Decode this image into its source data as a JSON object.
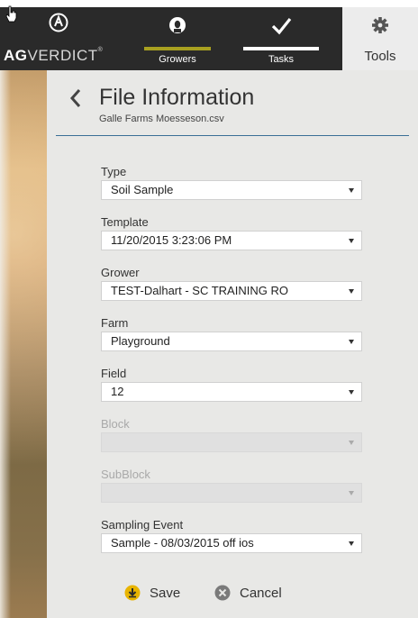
{
  "brand": {
    "bold": "AG",
    "rest": "VERDICT",
    "tm": "®"
  },
  "nav": {
    "tabs": [
      {
        "label": "Growers",
        "icon": "person-icon"
      },
      {
        "label": "Tasks",
        "icon": "checkmark-icon"
      },
      {
        "label": "Tools",
        "icon": "gear-icon"
      }
    ],
    "active_colors": {
      "growers": "#a8a020",
      "tasks": "#ffffff"
    }
  },
  "header": {
    "title": "File Information",
    "filename": "Galle Farms Moesseson.csv"
  },
  "form": {
    "type": {
      "label": "Type",
      "value": "Soil Sample"
    },
    "template": {
      "label": "Template",
      "value": "11/20/2015 3:23:06 PM"
    },
    "grower": {
      "label": "Grower",
      "value": "TEST-Dalhart - SC TRAINING RO"
    },
    "farm": {
      "label": "Farm",
      "value": "Playground"
    },
    "field": {
      "label": "Field",
      "value": "12"
    },
    "block": {
      "label": "Block",
      "value": ""
    },
    "subblock": {
      "label": "SubBlock",
      "value": ""
    },
    "sampling_event": {
      "label": "Sampling Event",
      "value": "Sample - 08/03/2015 off ios"
    }
  },
  "actions": {
    "save": "Save",
    "cancel": "Cancel"
  },
  "colors": {
    "accent_divider": "#3a6f96",
    "save_icon": "#e8b400",
    "topbar": "#2a2a2a"
  }
}
